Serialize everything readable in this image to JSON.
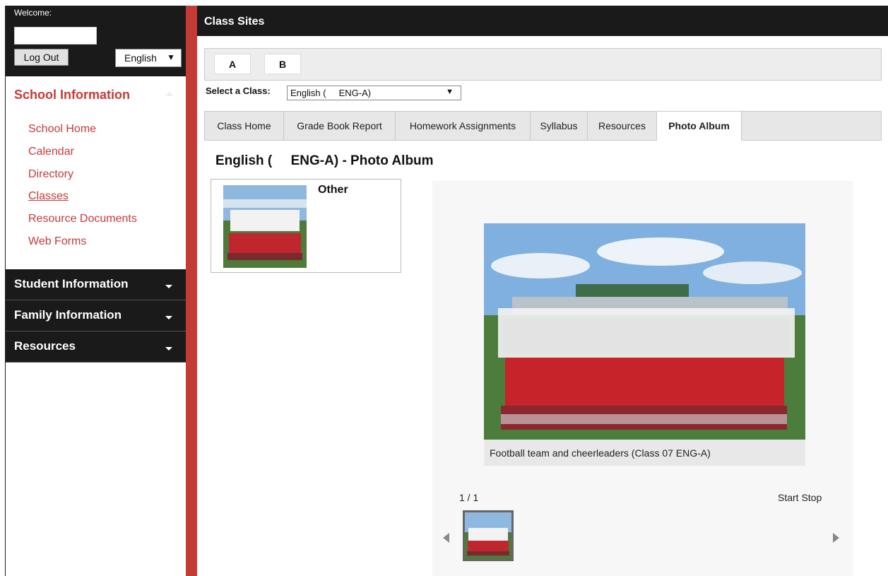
{
  "sidebar": {
    "welcome": "Welcome:",
    "logout": "Log Out",
    "language": "English",
    "school_header": "School Information",
    "school_links": [
      "School Home",
      "Calendar",
      "Directory",
      "Classes",
      "Resource Documents",
      "Web Forms"
    ],
    "sections": [
      "Student Information",
      "Family Information",
      "Resources"
    ]
  },
  "main": {
    "title": "Class Sites",
    "letter_tabs": [
      "A",
      "B"
    ],
    "select_label": "Select a Class:",
    "select_value": "English (     ENG-A)",
    "tabs": [
      "Class Home",
      "Grade Book Report",
      "Homework Assignments",
      "Syllabus",
      "Resources",
      "Photo Album"
    ],
    "active_tab": "Photo Album",
    "album_title": "English (     ENG-A) - Photo Album",
    "album_name": "Other",
    "caption": "Football team and cheerleaders (Class 07 ENG-A)",
    "counter": "1 / 1",
    "start_stop": "Start Stop"
  },
  "colors": {
    "accent": "#c63a36",
    "dark": "#1a1a1a",
    "tabbar": "#e7e7e7"
  }
}
